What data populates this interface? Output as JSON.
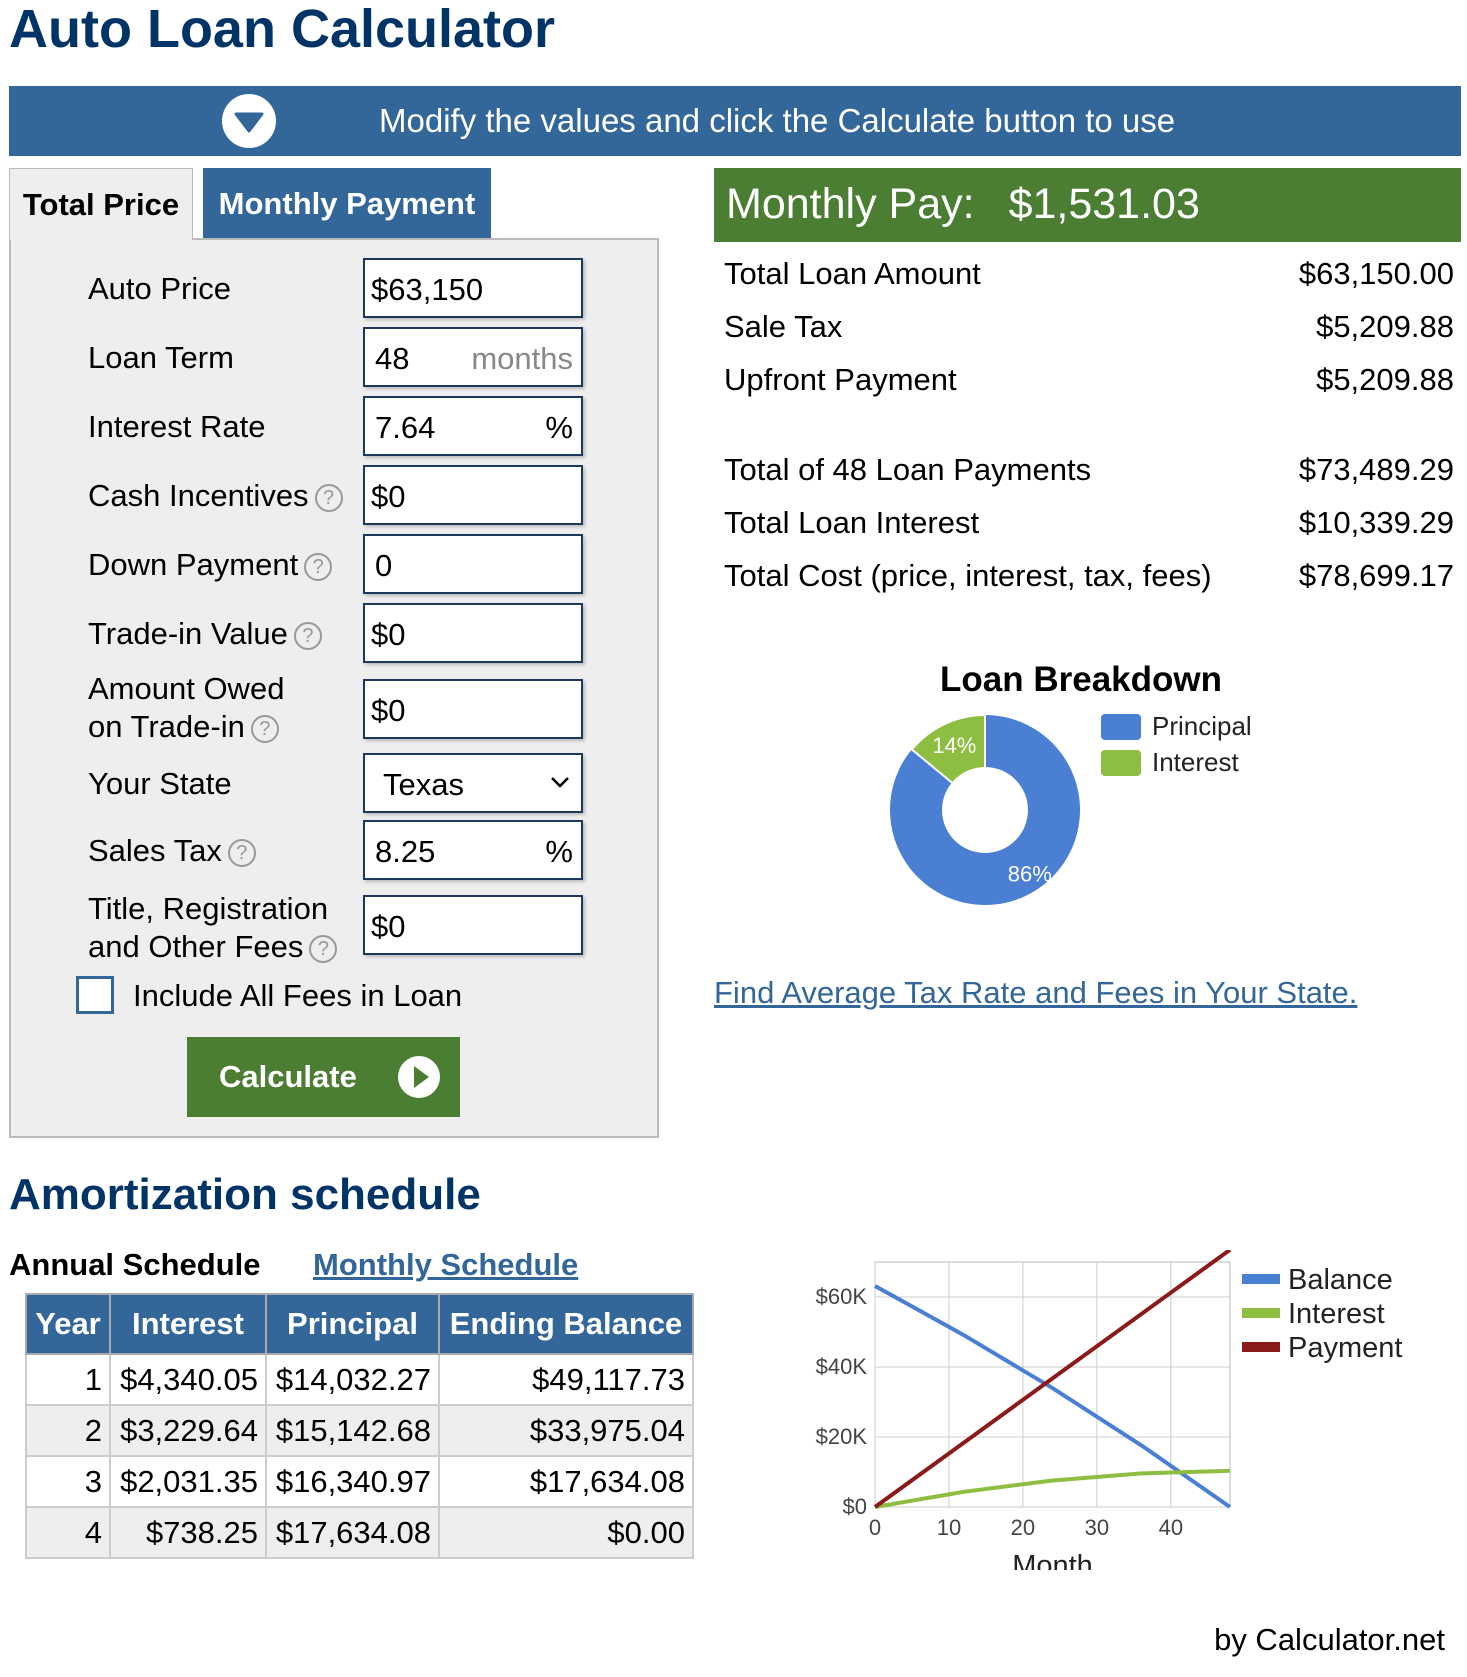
{
  "title": "Auto Loan Calculator",
  "banner": {
    "text": "Modify the values and click the Calculate button to use",
    "icon": "chevron-down-circle-icon"
  },
  "tabs": [
    {
      "label": "Total Price",
      "active": true
    },
    {
      "label": "Monthly Payment",
      "active": false
    }
  ],
  "form": {
    "auto_price": {
      "label": "Auto Price",
      "value": "$63,150"
    },
    "loan_term": {
      "label": "Loan Term",
      "value": "48",
      "suffix": "months"
    },
    "interest_rate": {
      "label": "Interest Rate",
      "value": "7.64",
      "suffix": "%"
    },
    "cash_incentives": {
      "label": "Cash Incentives",
      "value": "$0"
    },
    "down_payment": {
      "label": "Down Payment",
      "value": "0"
    },
    "trade_in_value": {
      "label": "Trade-in Value",
      "value": "$0"
    },
    "amount_owed": {
      "label_line1": "Amount Owed",
      "label_line2": "on Trade-in",
      "value": "$0"
    },
    "your_state": {
      "label": "Your State",
      "value": "Texas"
    },
    "sales_tax": {
      "label": "Sales Tax",
      "value": "8.25",
      "suffix": "%"
    },
    "fees": {
      "label_line1": "Title, Registration",
      "label_line2": "and Other Fees",
      "value": "$0"
    },
    "include_fees": {
      "label": "Include All Fees in Loan",
      "checked": false
    },
    "help_glyph": "?",
    "calculate_label": "Calculate"
  },
  "results": {
    "monthly_pay_label": "Monthly Pay:",
    "monthly_pay_value": "$1,531.03",
    "rows": [
      {
        "label": "Total Loan Amount",
        "value": "$63,150.00"
      },
      {
        "label": "Sale Tax",
        "value": "$5,209.88"
      },
      {
        "label": "Upfront Payment",
        "value": "$5,209.88"
      },
      {
        "label": "Total of 48 Loan Payments",
        "value": "$73,489.29"
      },
      {
        "label": "Total Loan Interest",
        "value": "$10,339.29"
      },
      {
        "label": "Total Cost (price, interest, tax, fees)",
        "value": "$78,699.17"
      }
    ]
  },
  "pie": {
    "title": "Loan Breakdown",
    "slices": [
      {
        "name": "Principal",
        "percent": 86,
        "label": "86%",
        "color": "#4a7fd4"
      },
      {
        "name": "Interest",
        "percent": 14,
        "label": "14%",
        "color": "#8ebe41"
      }
    ]
  },
  "link_text": "Find Average Tax Rate and Fees in Your State.",
  "amortization": {
    "heading": "Amortization schedule",
    "tab_annual": "Annual Schedule",
    "tab_monthly": "Monthly Schedule",
    "columns": [
      "Year",
      "Interest",
      "Principal",
      "Ending Balance"
    ],
    "rows": [
      [
        "1",
        "$4,340.05",
        "$14,032.27",
        "$49,117.73"
      ],
      [
        "2",
        "$3,229.64",
        "$15,142.68",
        "$33,975.04"
      ],
      [
        "3",
        "$2,031.35",
        "$16,340.97",
        "$17,634.08"
      ],
      [
        "4",
        "$738.25",
        "$17,634.08",
        "$0.00"
      ]
    ]
  },
  "chart_data": {
    "type": "line",
    "xlabel": "Month",
    "ylabel": "",
    "x_ticks": [
      "0",
      "10",
      "20",
      "30",
      "40"
    ],
    "y_ticks": [
      "$0",
      "$20K",
      "$40K",
      "$60K"
    ],
    "xlim": [
      0,
      48
    ],
    "ylim": [
      0,
      70000
    ],
    "grid": true,
    "legend_position": "right",
    "series": [
      {
        "name": "Balance",
        "color": "#4a7fd4",
        "x": [
          0,
          12,
          24,
          36,
          48
        ],
        "values": [
          63150,
          49117.73,
          33975.04,
          17634.08,
          0
        ]
      },
      {
        "name": "Interest",
        "color": "#8ebe41",
        "x": [
          0,
          12,
          24,
          36,
          48
        ],
        "values": [
          0,
          4340.05,
          7569.69,
          9601.04,
          10339.29
        ]
      },
      {
        "name": "Payment",
        "color": "#8b1a1a",
        "x": [
          0,
          12,
          24,
          36,
          48
        ],
        "values": [
          0,
          18372.32,
          36744.64,
          55116.96,
          73489.29
        ]
      }
    ]
  },
  "footer": "by Calculator.net"
}
